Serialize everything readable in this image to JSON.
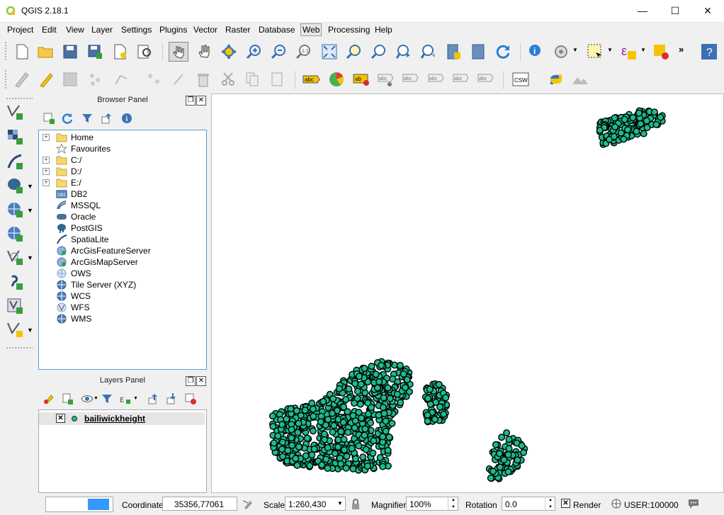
{
  "window": {
    "title": "QGIS 2.18.1",
    "minimize": "—",
    "maximize": "☐",
    "close": "✕"
  },
  "menu": [
    "Project",
    "Edit",
    "View",
    "Layer",
    "Settings",
    "Plugins",
    "Vector",
    "Raster",
    "Database",
    "Web",
    "Processing",
    "Help"
  ],
  "browser_panel": {
    "title": "Browser Panel",
    "items": [
      {
        "label": "Home",
        "icon": "folder-icon",
        "expandable": true
      },
      {
        "label": "Favourites",
        "icon": "star-icon",
        "expandable": false
      },
      {
        "label": "C:/",
        "icon": "folder-icon",
        "expandable": true
      },
      {
        "label": "D:/",
        "icon": "folder-icon",
        "expandable": true
      },
      {
        "label": "E:/",
        "icon": "folder-icon",
        "expandable": true
      },
      {
        "label": "DB2",
        "icon": "db2-icon",
        "expandable": false
      },
      {
        "label": "MSSQL",
        "icon": "mssql-icon",
        "expandable": false
      },
      {
        "label": "Oracle",
        "icon": "oracle-icon",
        "expandable": false
      },
      {
        "label": "PostGIS",
        "icon": "postgis-icon",
        "expandable": false
      },
      {
        "label": "SpatiaLite",
        "icon": "spatialite-icon",
        "expandable": false
      },
      {
        "label": "ArcGisFeatureServer",
        "icon": "arcgis-icon",
        "expandable": false
      },
      {
        "label": "ArcGisMapServer",
        "icon": "arcgis-icon",
        "expandable": false
      },
      {
        "label": "OWS",
        "icon": "globe-icon",
        "expandable": false
      },
      {
        "label": "Tile Server (XYZ)",
        "icon": "globe-icon",
        "expandable": false
      },
      {
        "label": "WCS",
        "icon": "globe-icon",
        "expandable": false
      },
      {
        "label": "WFS",
        "icon": "globe-icon",
        "expandable": false
      },
      {
        "label": "WMS",
        "icon": "globe-icon",
        "expandable": false
      }
    ]
  },
  "layers_panel": {
    "title": "Layers Panel",
    "layers": [
      {
        "name": "bailiwickheight",
        "visible": true,
        "symbol_color": "#1abc8c"
      }
    ]
  },
  "map": {
    "point_color": "#1abc8c",
    "stroke_color": "#000000"
  },
  "status": {
    "coordinate_label": "Coordinate",
    "coordinate_value": "35356,77061",
    "scale_label": "Scale",
    "scale_value": "1:260,430",
    "magnifier_label": "Magnifier",
    "magnifier_value": "100%",
    "rotation_label": "Rotation",
    "rotation_value": "0.0",
    "render_label": "Render",
    "render_checked": true,
    "crs_label": "USER:100000"
  }
}
